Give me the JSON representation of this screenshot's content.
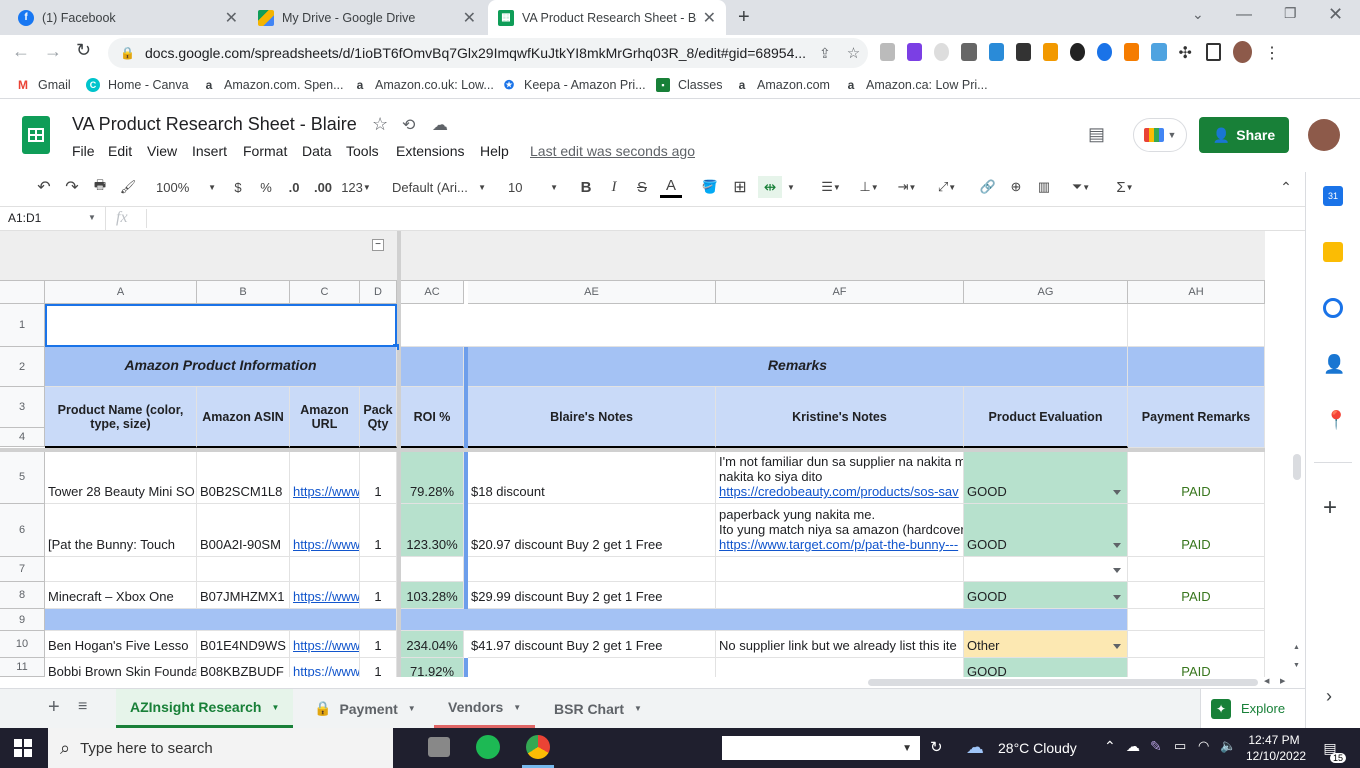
{
  "browser": {
    "tabs": [
      {
        "title": "(1) Facebook",
        "icon": "facebook-icon"
      },
      {
        "title": "My Drive - Google Drive",
        "icon": "drive-icon"
      },
      {
        "title": "VA Product Research Sheet - Blair",
        "icon": "sheets-icon"
      }
    ],
    "url": "docs.google.com/spreadsheets/d/1ioBT6fOmvBq7Glx29ImqwfKuJtkYI8mkMrGrhq03R_8/edit#gid=68954...",
    "bookmarks": [
      {
        "label": "Gmail"
      },
      {
        "label": "Home - Canva"
      },
      {
        "label": "Amazon.com. Spen..."
      },
      {
        "label": "Amazon.co.uk: Low..."
      },
      {
        "label": "Keepa - Amazon Pri..."
      },
      {
        "label": "Classes"
      },
      {
        "label": "Amazon.com"
      },
      {
        "label": "Amazon.ca: Low Pri..."
      }
    ]
  },
  "doc": {
    "title": "VA Product Research Sheet - Blaire",
    "menus": [
      "File",
      "Edit",
      "View",
      "Insert",
      "Format",
      "Data",
      "Tools",
      "Extensions",
      "Help"
    ],
    "last_edit": "Last edit was seconds ago",
    "share_label": "Share"
  },
  "toolbar": {
    "zoom": "100%",
    "currency": "$",
    "percent": "%",
    "dec_less": ".0",
    "dec_more": ".00",
    "format_123": "123",
    "font": "Default (Ari...",
    "font_size": "10",
    "bold": "B",
    "italic": "I",
    "strike": "S",
    "text_color": "A"
  },
  "formula_bar": {
    "name_box": "A1:D1",
    "fx": "fx",
    "value": ""
  },
  "columns": [
    "A",
    "B",
    "C",
    "D",
    "AC",
    "AE",
    "AF",
    "AG",
    "AH"
  ],
  "rows": [
    "1",
    "2",
    "3",
    "4",
    "5",
    "6",
    "7",
    "8",
    "9",
    "10",
    "11"
  ],
  "sheet": {
    "section_product": "Amazon Product Information",
    "section_remarks": "Remarks",
    "headers": {
      "product_name": "Product Name (color, type, size)",
      "asin": "Amazon ASIN",
      "url": "Amazon URL",
      "pack": "Pack Qty",
      "roi": "ROI %",
      "blaire": "Blaire's Notes",
      "kristine": "Kristine's Notes",
      "evaluation": "Product Evaluation",
      "payment": "Payment Remarks"
    },
    "data_rows": [
      {
        "name": "Tower 28 Beauty Mini SO",
        "asin": "B0B2SCM1L8",
        "url": "https://www",
        "qty": "1",
        "roi": "79.28%",
        "notes": "$18 discount",
        "k1": "I'm not familiar dun sa supplier na nakita m",
        "k2": "nakita ko siya dito",
        "k_link": "https://credobeauty.com/products/sos-sav",
        "eval": "GOOD",
        "pay": "PAID"
      },
      {
        "name": "[Pat the Bunny: Touch",
        "asin": "B00A2I-90SM",
        "url": "https://www",
        "qty": "1",
        "roi": "123.30%",
        "notes": "$20.97 discount Buy 2 get 1 Free",
        "k1": "paperback yung nakita me.",
        "k2": "Ito yung match niya sa amazon (hardcover",
        "k_link": "https://www.target.com/p/pat-the-bunny---",
        "eval": "GOOD",
        "pay": "PAID"
      },
      {
        "name": "Minecraft – Xbox One",
        "asin": "B07JMHZMX1",
        "url": "https://www",
        "qty": "1",
        "roi": "103.28%",
        "notes": "$29.99 discount Buy 2 get 1 Free",
        "eval": "GOOD",
        "pay": "PAID"
      },
      {
        "name": "Ben Hogan's Five Lesso",
        "asin": "B01E4ND9WS",
        "url": "https://www",
        "qty": "1",
        "roi": "234.04%",
        "notes": "$41.97 discount Buy 2 get 1 Free",
        "k1": "No supplier link but we already list this ite",
        "eval": "Other",
        "pay": ""
      },
      {
        "name": "Bobbi Brown Skin Foundat",
        "asin": "B08KBZBUDF",
        "url": "https://www",
        "qty": "1",
        "roi": "71.92%",
        "eval": "GOOD",
        "pay": "PAID"
      }
    ]
  },
  "sheet_tabs": [
    "AZInsight Research",
    "Payment",
    "Vendors",
    "BSR Chart"
  ],
  "explore_label": "Explore",
  "taskbar": {
    "search_placeholder": "Type here to search",
    "weather": "28°C  Cloudy",
    "time": "12:47 PM",
    "date": "12/10/2022",
    "notifications": "15"
  },
  "colors": {
    "header_blue": "#c9daf8",
    "good_green": "#b7e1cd",
    "other_yellow": "#fce8b2",
    "link": "#1155cc",
    "share_green": "#188038"
  }
}
